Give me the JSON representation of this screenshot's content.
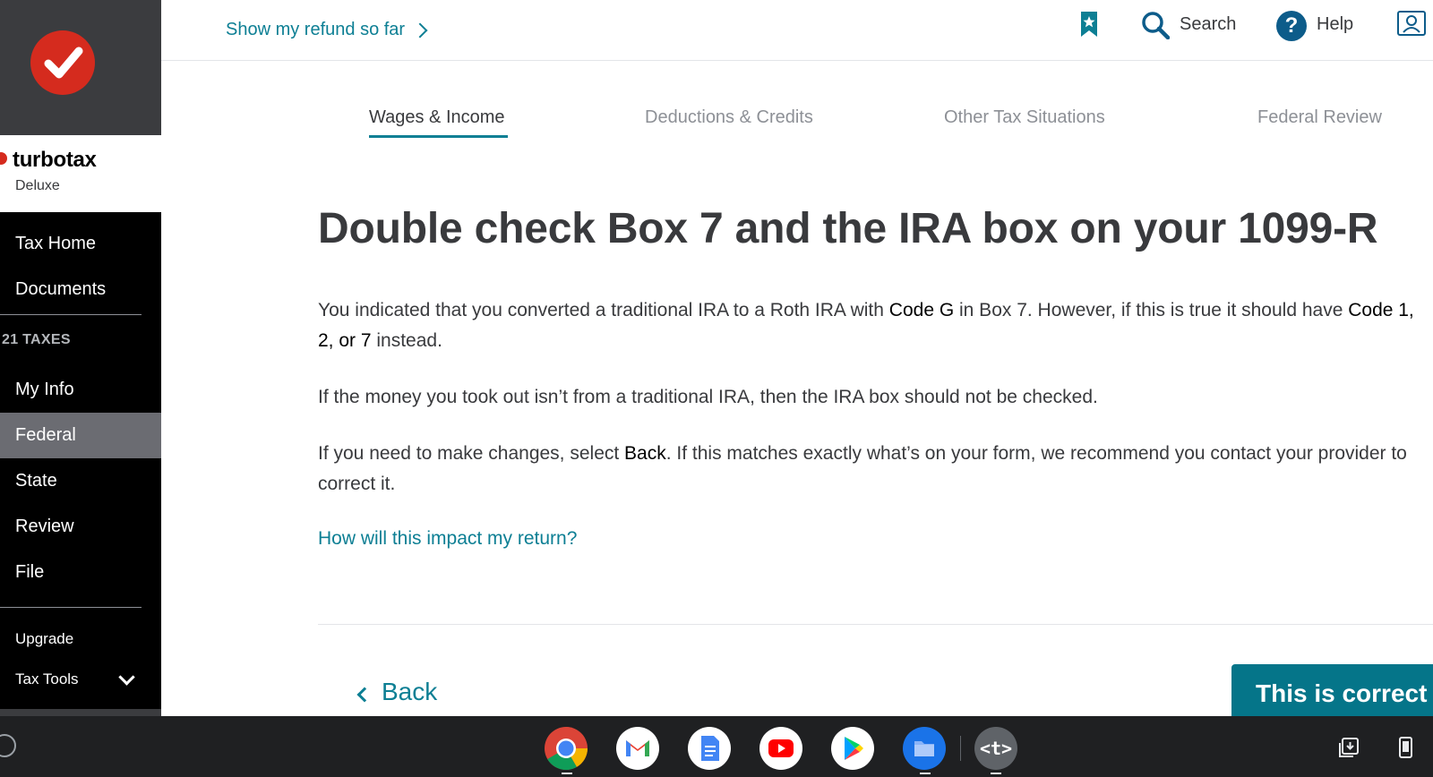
{
  "sidebar": {
    "brand_name": "turbotax",
    "brand_edition": "Deluxe",
    "nav": {
      "tax_home": "Tax Home",
      "documents": "Documents",
      "section_label": "21 TAXES",
      "my_info": "My Info",
      "federal": "Federal",
      "state": "State",
      "review": "Review",
      "file": "File",
      "upgrade": "Upgrade",
      "tax_tools": "Tax Tools"
    },
    "active_item": "Federal"
  },
  "header": {
    "refund_link": "Show my refund so far",
    "search_label": "Search",
    "help_label": "Help",
    "help_glyph": "?",
    "icons": [
      "bookmark-icon",
      "search-icon",
      "help-icon",
      "profile-icon"
    ]
  },
  "tabs": [
    {
      "label": "Wages & Income",
      "active": true
    },
    {
      "label": "Deductions & Credits",
      "active": false
    },
    {
      "label": "Other Tax Situations",
      "active": false
    },
    {
      "label": "Federal Review",
      "active": false
    }
  ],
  "main": {
    "title": "Double check Box 7 and the IRA box on your 1099-R",
    "p1_a": "You indicated that you converted a traditional IRA to a Roth IRA with ",
    "p1_b": "Code G",
    "p1_c": " in Box 7. However, if this is true it should have ",
    "p1_d": "Code 1, 2, or 7",
    "p1_e": " instead.",
    "p2": "If the money you took out isn’t from a traditional IRA, then the IRA box should not be checked.",
    "p3_a": "If you need to make changes, select ",
    "p3_b": "Back",
    "p3_c": ". If this matches exactly what’s on your form, we recommend you contact your provider to correct it.",
    "impact_link": "How will this impact my return?",
    "back_label": "Back",
    "correct_label": "This is correct"
  },
  "shelf": {
    "apps": [
      "chrome-icon",
      "gmail-icon",
      "docs-icon",
      "youtube-icon",
      "play-store-icon",
      "files-icon",
      "terminal-icon"
    ],
    "terminal_glyph": "<t>",
    "tray": [
      "screenshot-icon",
      "phone-hub-icon"
    ]
  },
  "colors": {
    "accent": "#0d7f94",
    "primary_button": "#057589",
    "brand_red": "#d52b1e",
    "sidebar_bg": "#000000",
    "sidebar_active": "#6b6c72"
  }
}
